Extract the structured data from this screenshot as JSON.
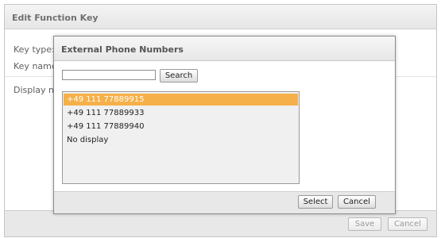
{
  "background_dialog": {
    "title": "Edit Function Key",
    "labels": {
      "key_type": "Key type:",
      "key_name": "Key name",
      "display_number": "Display nu"
    },
    "footer": {
      "save_label": "Save",
      "cancel_label": "Cancel"
    }
  },
  "modal": {
    "title": "External Phone Numbers",
    "search": {
      "value": "",
      "placeholder": "",
      "button_label": "Search"
    },
    "list": {
      "items": [
        "+49 111 77889915",
        "+49 111 77889933",
        "+49 111 77889940",
        "No display"
      ],
      "selected_index": 0
    },
    "footer": {
      "select_label": "Select",
      "cancel_label": "Cancel"
    }
  },
  "colors": {
    "selection": "#f6b049",
    "header_bg": "#e8e8e8",
    "border": "#8b8b8b"
  }
}
